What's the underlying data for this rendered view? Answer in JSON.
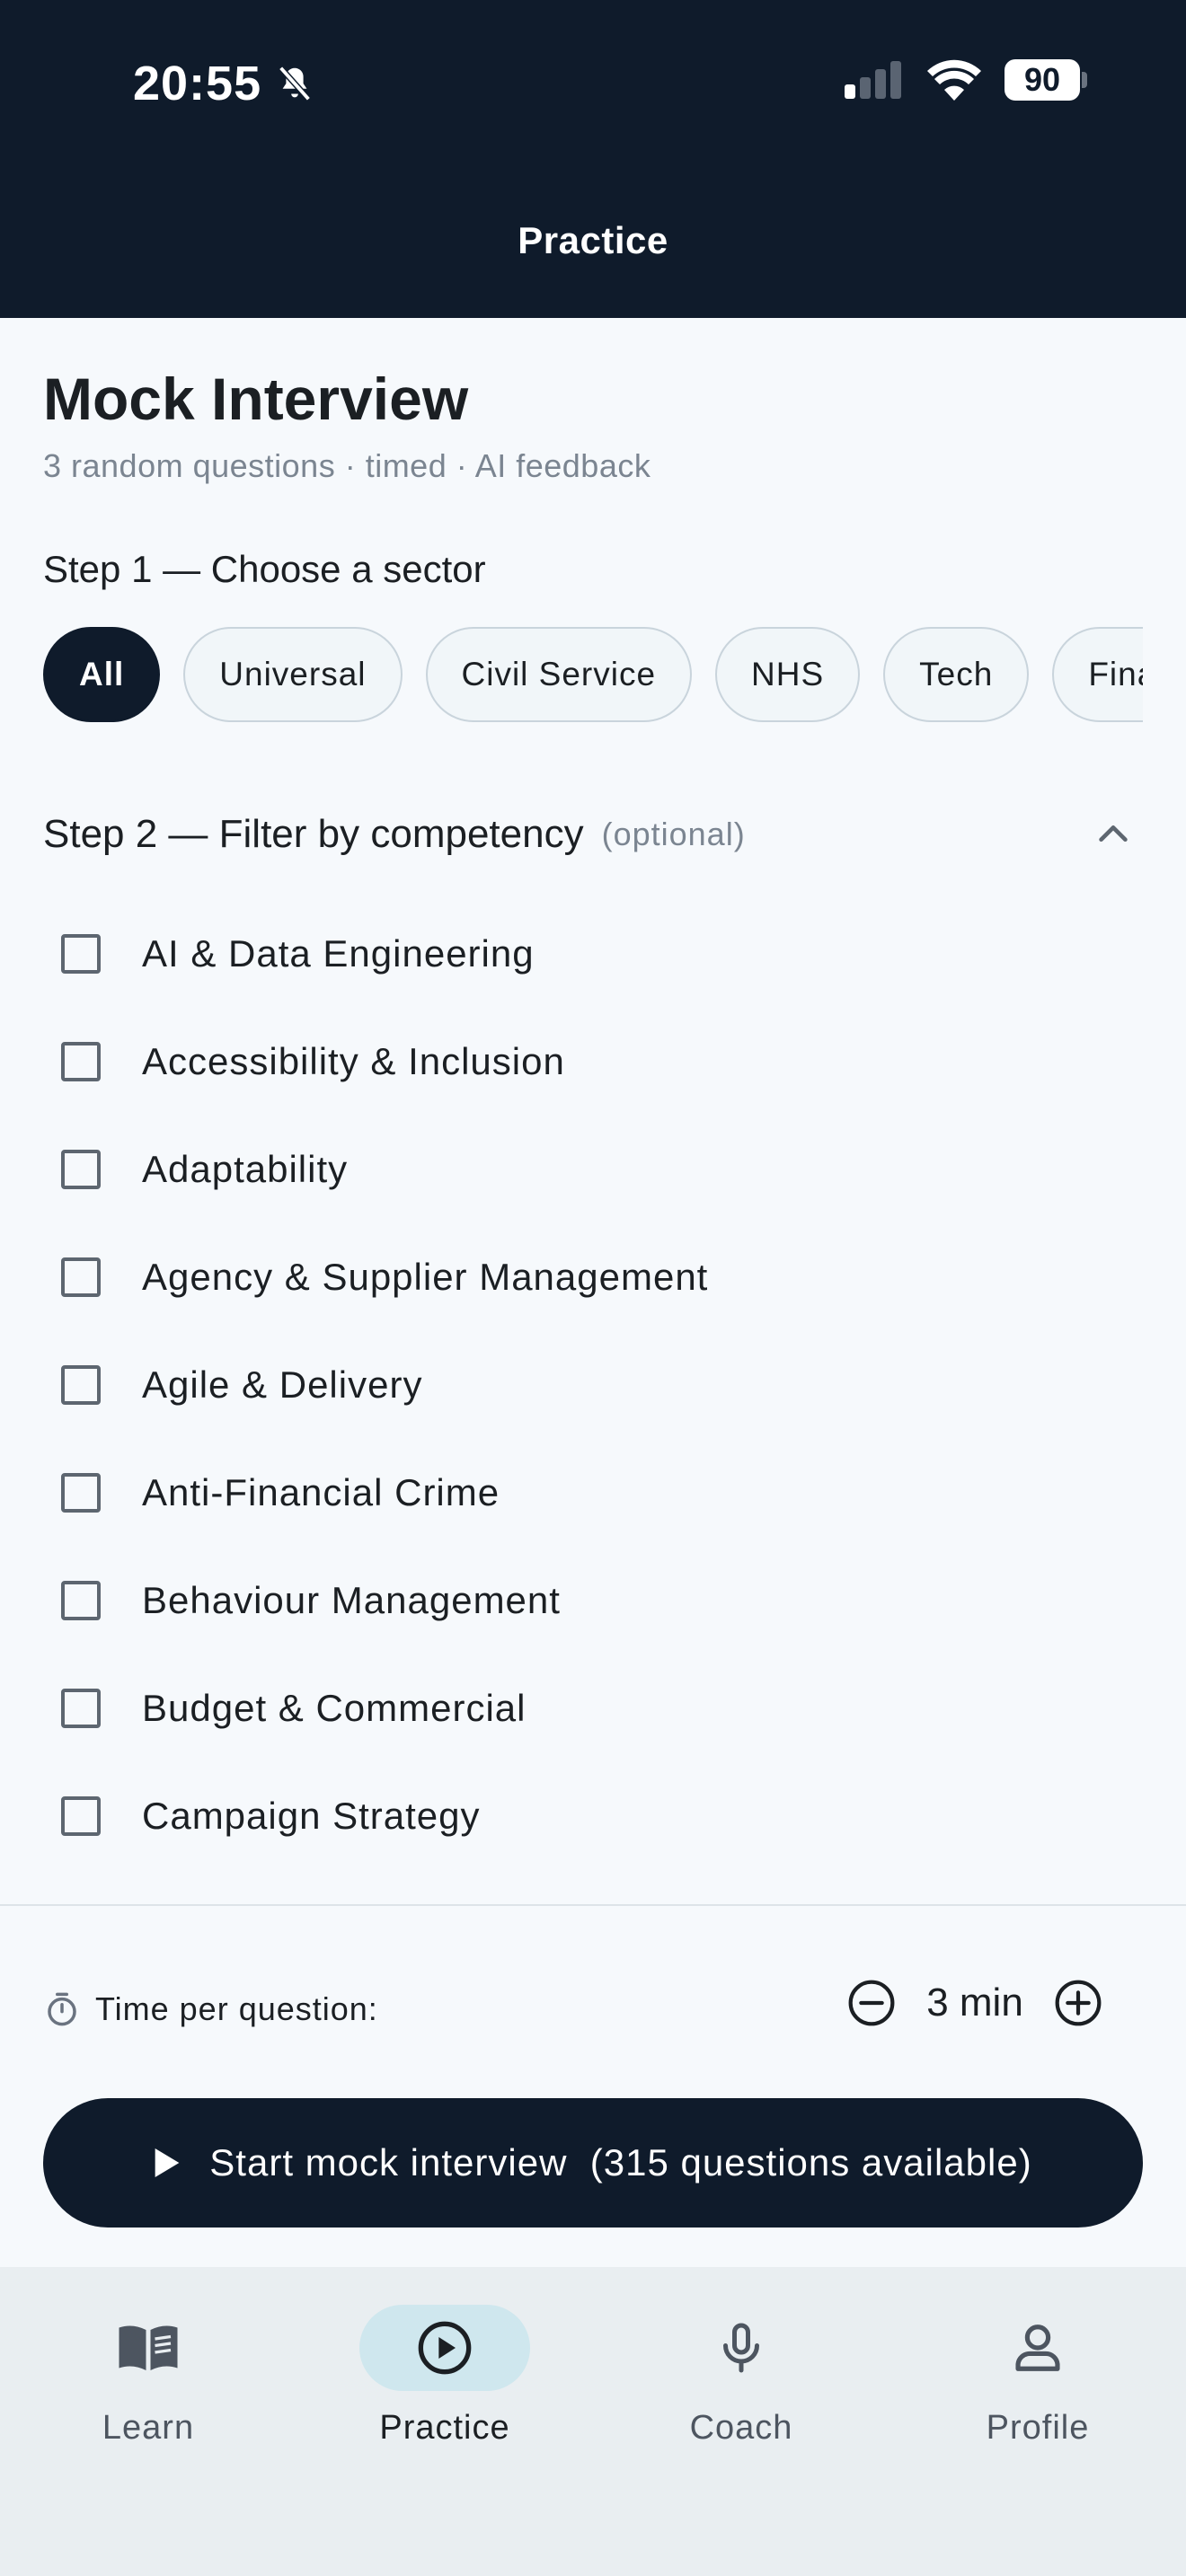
{
  "status_bar": {
    "time": "20:55",
    "battery": "90"
  },
  "header": {
    "title": "Practice"
  },
  "page": {
    "title": "Mock Interview",
    "subtitle": "3 random questions · timed · AI feedback"
  },
  "step1": {
    "label": "Step 1 — Choose a sector",
    "chips": [
      {
        "label": "All",
        "selected": true
      },
      {
        "label": "Universal",
        "selected": false
      },
      {
        "label": "Civil Service",
        "selected": false
      },
      {
        "label": "NHS",
        "selected": false
      },
      {
        "label": "Tech",
        "selected": false
      },
      {
        "label": "Fina",
        "selected": false
      }
    ]
  },
  "step2": {
    "label": "Step 2 — Filter by competency",
    "optional": "(optional)",
    "items": [
      "AI & Data Engineering",
      "Accessibility & Inclusion",
      "Adaptability",
      "Agency & Supplier Management",
      "Agile & Delivery",
      "Anti-Financial Crime",
      "Behaviour Management",
      "Budget & Commercial",
      "Campaign Strategy"
    ]
  },
  "timer": {
    "label": "Time per question:",
    "value": "3 min"
  },
  "start_button": {
    "label": "Start mock interview  (315 questions available)"
  },
  "nav": {
    "items": [
      {
        "label": "Learn",
        "icon": "book-icon",
        "active": false
      },
      {
        "label": "Practice",
        "icon": "play-circle-icon",
        "active": true
      },
      {
        "label": "Coach",
        "icon": "microphone-icon",
        "active": false
      },
      {
        "label": "Profile",
        "icon": "person-icon",
        "active": false
      }
    ]
  },
  "colors": {
    "primary": "#0f1b2b",
    "background": "#f6f9fc",
    "active_nav_pill": "#cfe7ee",
    "muted_text": "#7b8591"
  }
}
